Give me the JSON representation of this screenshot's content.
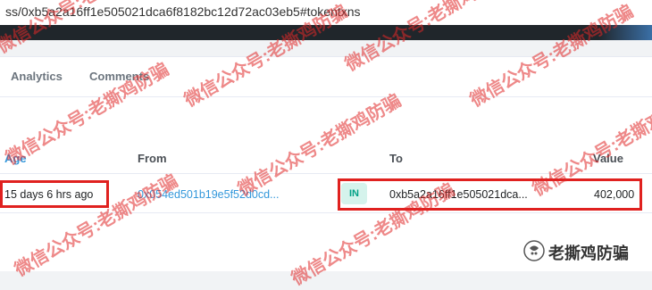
{
  "browser": {
    "url_fragment": "ss/0xb5a2a16ff1e505021dca6f8182bc12d72ac03eb5#tokentxns"
  },
  "tabs": [
    "Analytics",
    "Comments"
  ],
  "table": {
    "headers": {
      "age": "Age",
      "from": "From",
      "to": "To",
      "value": "Value"
    },
    "row": {
      "age": "15 days 6 hrs ago",
      "from": "0x054ed501b19e5f52d0cd...",
      "direction": "IN",
      "to": "0xb5a2a16ff1e505021dca...",
      "value": "402,000"
    }
  },
  "watermark": {
    "text": "微信公众号:老撕鸡防骗",
    "color": "#e02828"
  },
  "logo": {
    "text": "老撕鸡防骗",
    "icon": "wechat-official-account-icon"
  },
  "colors": {
    "highlight": "#e0211f",
    "link": "#3498db",
    "in_badge_bg": "#d5f3ec",
    "in_badge_text": "#00a186"
  }
}
